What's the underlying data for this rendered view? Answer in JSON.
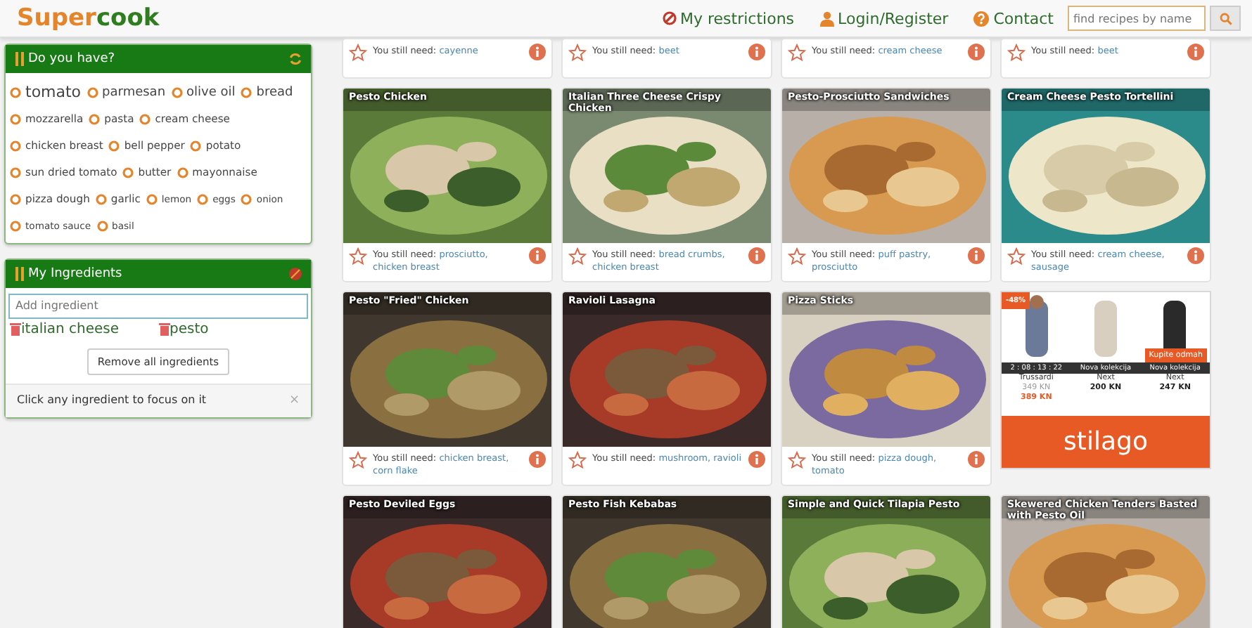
{
  "header": {
    "logo_first": "Super",
    "logo_second": "cook",
    "nav": [
      {
        "label": "My restrictions",
        "kind": "restrictions"
      },
      {
        "label": "Login/Register",
        "kind": "user"
      },
      {
        "label": "Contact",
        "kind": "contact"
      }
    ],
    "search": {
      "placeholder": "find recipes by name"
    }
  },
  "pantry": {
    "title": "Do you have?",
    "items": [
      {
        "label": "tomato",
        "kind": "large"
      },
      {
        "label": "parmesan",
        "kind": "medium"
      },
      {
        "label": "olive oil",
        "kind": "medium"
      },
      {
        "label": "bread",
        "kind": "medium"
      },
      {
        "label": "mozzarella",
        "kind": "normal"
      },
      {
        "label": "pasta",
        "kind": "normal"
      },
      {
        "label": "cream cheese",
        "kind": "normal"
      },
      {
        "label": "chicken breast",
        "kind": "normal"
      },
      {
        "label": "bell pepper",
        "kind": "normal"
      },
      {
        "label": "potato",
        "kind": "normal"
      },
      {
        "label": "sun dried tomato",
        "kind": "normal"
      },
      {
        "label": "butter",
        "kind": "normal"
      },
      {
        "label": "mayonnaise",
        "kind": "normal"
      },
      {
        "label": "pizza dough",
        "kind": "normal"
      },
      {
        "label": "garlic",
        "kind": "normal"
      },
      {
        "label": "lemon",
        "kind": "small"
      },
      {
        "label": "eggs",
        "kind": "small"
      },
      {
        "label": "onion",
        "kind": "small"
      },
      {
        "label": "tomato sauce",
        "kind": "small"
      },
      {
        "label": "basil",
        "kind": "small"
      }
    ]
  },
  "my_ingredients": {
    "title": "My Ingredients",
    "input": {
      "placeholder": "Add ingredient"
    },
    "items": [
      "italian cheese",
      "pesto"
    ],
    "remove_all": "Remove all ingredients",
    "hint": "Click any ingredient to focus on it",
    "hint_close": "×"
  },
  "partial_row": [
    {
      "need_label": "You still need:",
      "missing": "cayenne"
    },
    {
      "need_label": "You still need:",
      "missing": "beet"
    },
    {
      "need_label": "You still need:",
      "missing": "cream cheese"
    },
    {
      "need_label": "You still need:",
      "missing": "beet"
    }
  ],
  "recipes": [
    {
      "kind": "recipe",
      "title": "Pesto Chicken",
      "need_label": "You still need:",
      "missing": "prosciutto, chicken breast"
    },
    {
      "kind": "recipe",
      "title": "Italian Three Cheese Crispy Chicken",
      "need_label": "You still need:",
      "missing": "bread crumbs, chicken breast"
    },
    {
      "kind": "recipe",
      "title": "Pesto-Prosciutto Sandwiches",
      "need_label": "You still need:",
      "missing": "puff pastry, prosciutto"
    },
    {
      "kind": "recipe",
      "title": "Cream Cheese Pesto Tortellini",
      "need_label": "You still need:",
      "missing": "cream cheese, sausage"
    },
    {
      "kind": "recipe",
      "title": "Pesto \"Fried\" Chicken",
      "need_label": "You still need:",
      "missing": "chicken breast, corn flake"
    },
    {
      "kind": "recipe",
      "title": "Ravioli Lasagna",
      "need_label": "You still need:",
      "missing": "mushroom, ravioli"
    },
    {
      "kind": "recipe",
      "title": "Pizza Sticks",
      "need_label": "You still need:",
      "missing": "pizza dough, tomato"
    },
    {
      "kind": "ad",
      "discount": "-48%",
      "timer": "2 : 08 : 13 : 22",
      "products": [
        {
          "tag": "Trussardi",
          "old_price": "349 KN",
          "price": "389 KN"
        },
        {
          "tag": "Nova kolekcija",
          "brand": "Next",
          "price": "200 KN"
        },
        {
          "tag": "Nova kolekcija",
          "brand": "Next",
          "price": "247 KN",
          "cta": "Kupite odmah"
        }
      ],
      "brand": "stilago"
    },
    {
      "kind": "recipe",
      "title": "Pesto Deviled Eggs"
    },
    {
      "kind": "recipe",
      "title": "Pesto Fish Kebabas"
    },
    {
      "kind": "recipe",
      "title": "Simple and Quick Tilapia Pesto"
    },
    {
      "kind": "recipe",
      "title": "Skewered Chicken Tenders Basted with Pesto Oil"
    }
  ]
}
